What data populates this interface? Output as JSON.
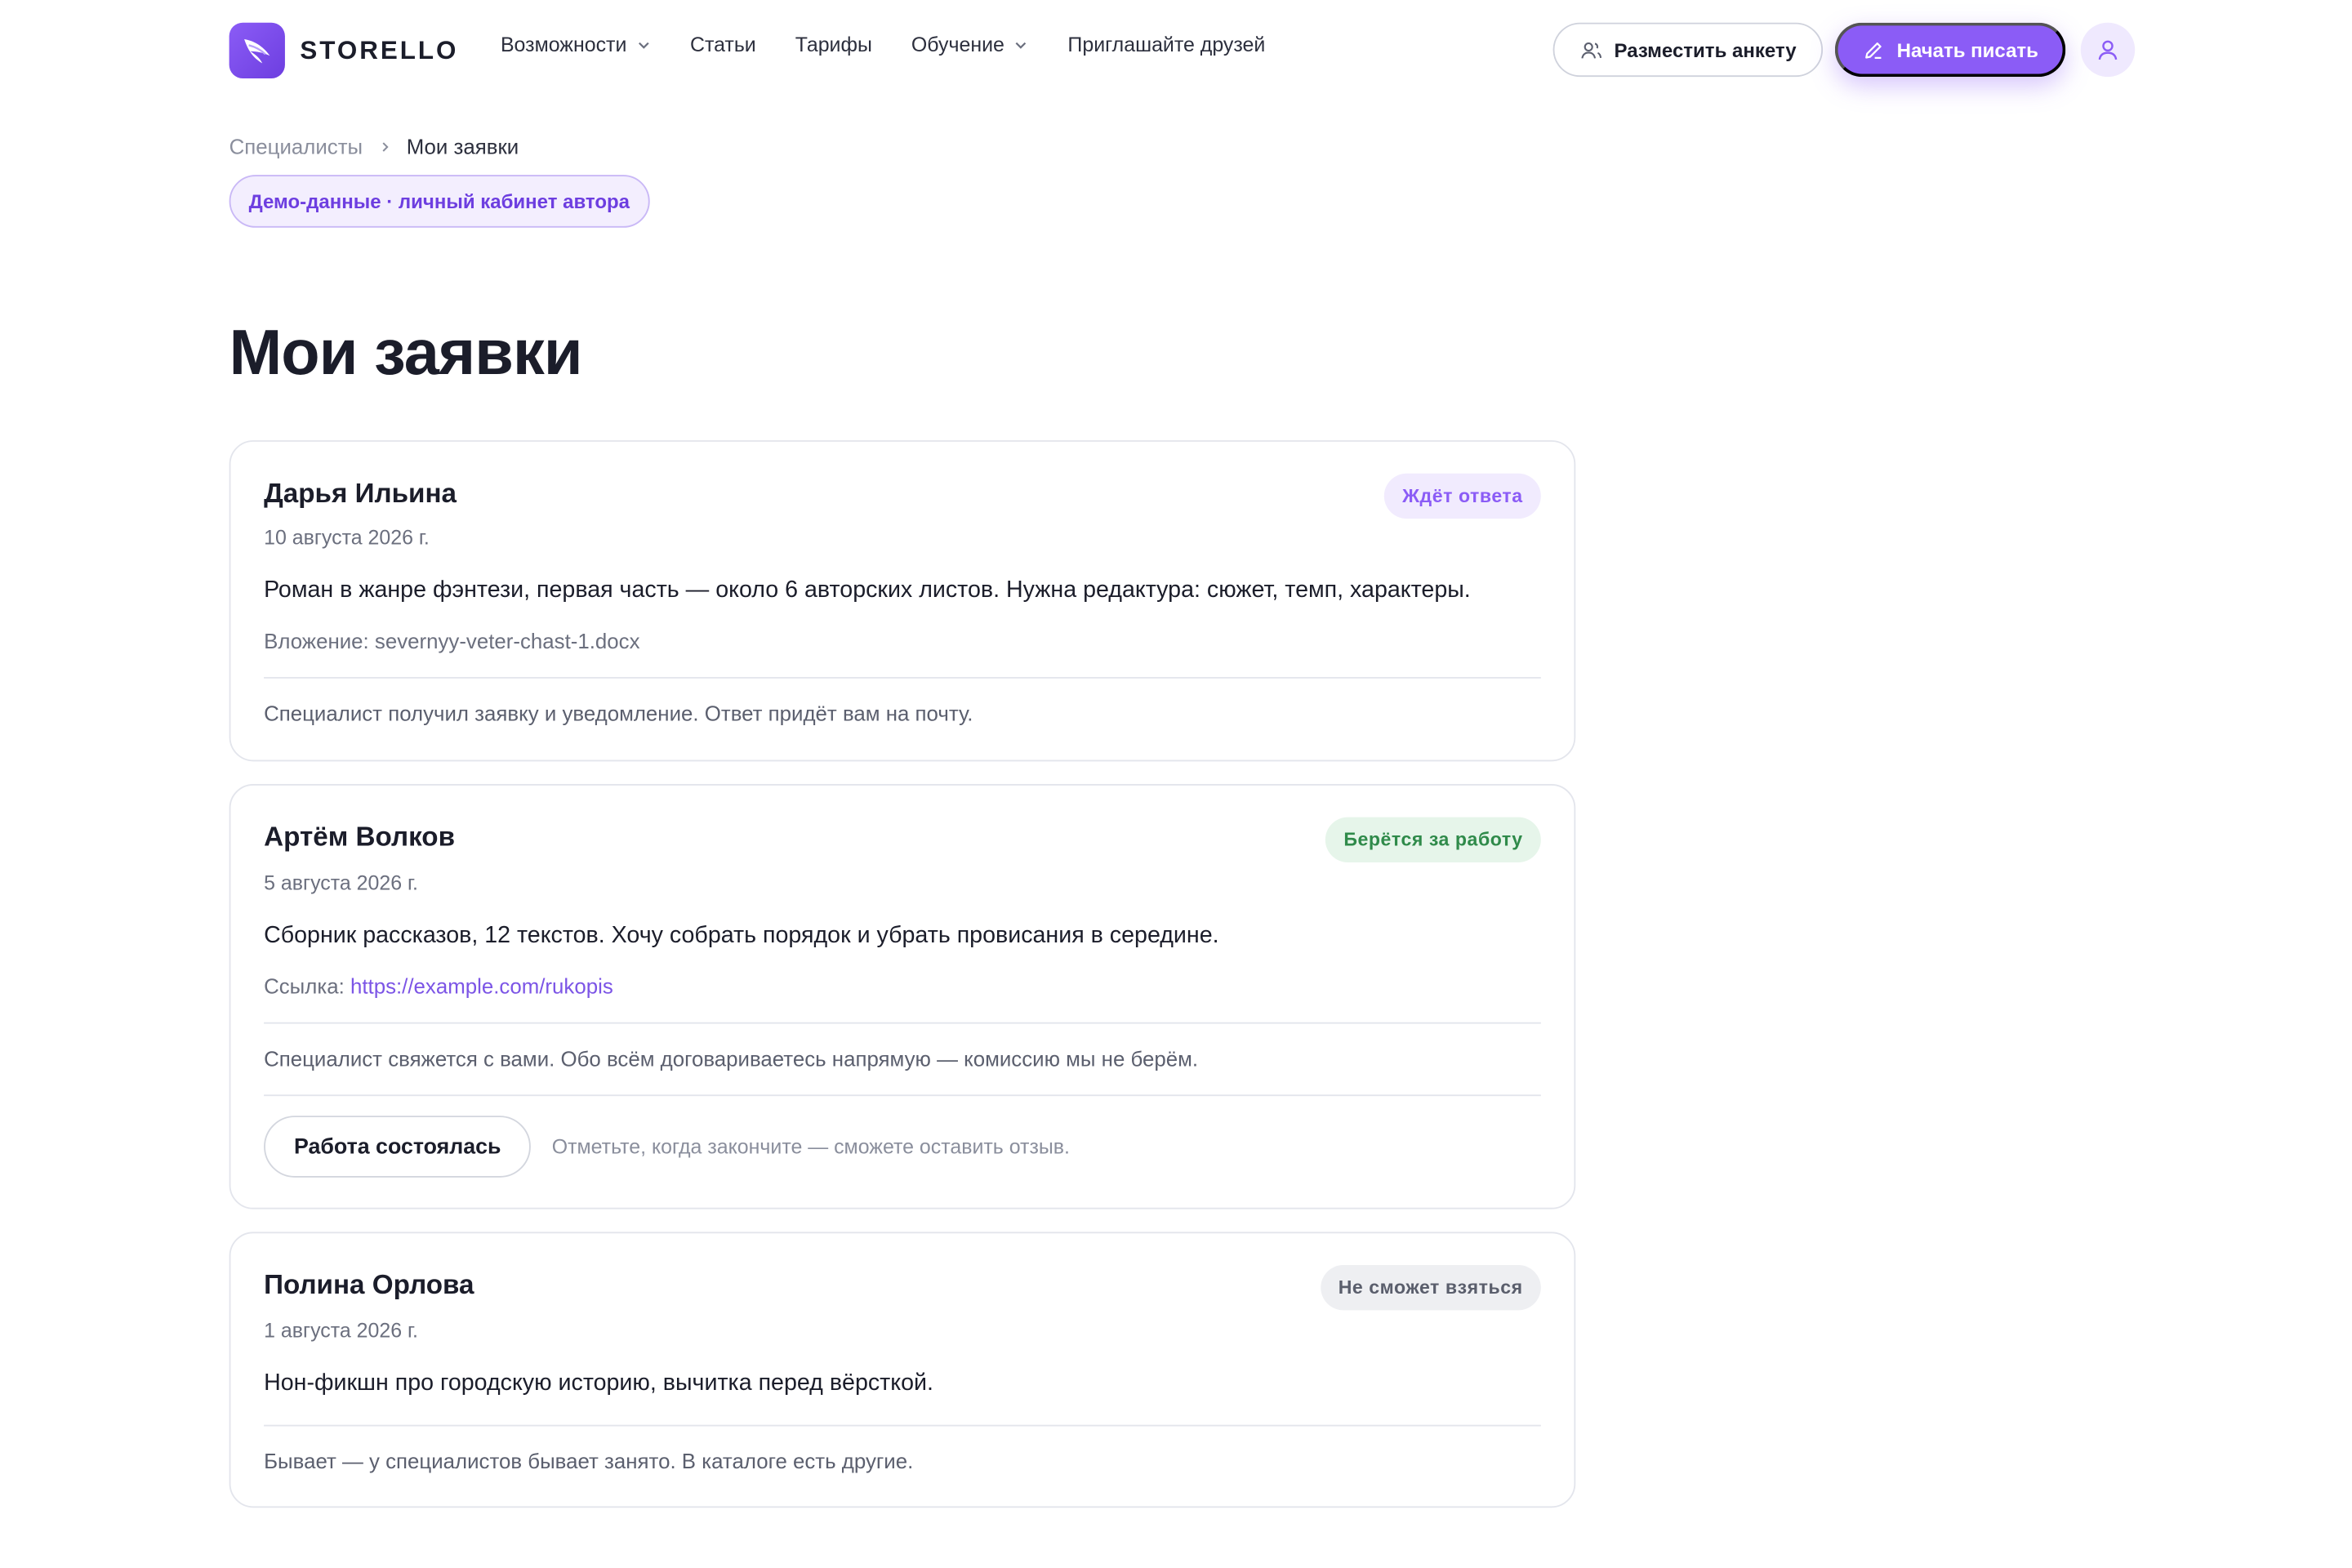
{
  "header": {
    "brand": "STORELLO",
    "nav": [
      {
        "label": "Возможности",
        "has_dropdown": true
      },
      {
        "label": "Статьи",
        "has_dropdown": false
      },
      {
        "label": "Тарифы",
        "has_dropdown": false
      },
      {
        "label": "Обучение",
        "has_dropdown": true
      },
      {
        "label": "Приглашайте друзей",
        "has_dropdown": false
      }
    ],
    "post_profile_label": "Разместить анкету",
    "start_writing_label": "Начать писать"
  },
  "breadcrumb": {
    "parent": "Специалисты",
    "current": "Мои заявки"
  },
  "demo_badge": "Демо-данные · личный кабинет автора",
  "page_title": "Мои заявки",
  "requests": [
    {
      "name": "Дарья Ильина",
      "date": "10 августа 2026 г.",
      "status": "Ждёт ответа",
      "description": "Роман в жанре фэнтези, первая часть — около 6 авторских листов. Нужна редактура: сюжет, темп, характеры.",
      "attachment_label": "Вложение:",
      "attachment_value": "severnyy-veter-chast-1.docx",
      "note": "Специалист получил заявку и уведомление. Ответ придёт вам на почту."
    },
    {
      "name": "Артём Волков",
      "date": "5 августа 2026 г.",
      "status": "Берётся за работу",
      "description": "Сборник рассказов, 12 текстов. Хочу собрать порядок и убрать провисания в середине.",
      "link_label": "Ссылка:",
      "link_value": "https://example.com/rukopis",
      "note": "Специалист свяжется с вами. Обо всём договариваетесь напрямую — комиссию мы не берём.",
      "done_button": "Работа состоялась",
      "done_hint": "Отметьте, когда закончите — сможете оставить отзыв."
    },
    {
      "name": "Полина Орлова",
      "date": "1 августа 2026 г.",
      "status": "Не сможет взяться",
      "description": "Нон-фикшн про городскую историю, вычитка перед вёрсткой.",
      "note": "Бывает — у специалистов бывает занято. В каталоге есть другие."
    }
  ],
  "colors": {
    "accent": "#8b5cf6",
    "status_waiting": "#8b5cf6",
    "status_accepted": "#2f8a4a",
    "status_declined": "#5a5e6c"
  },
  "icons": {
    "logo": "feather-logo-icon",
    "dropdown": "chevron-down-icon",
    "post_profile": "users-icon",
    "start_writing": "pencil-icon",
    "account": "user-icon",
    "breadcrumb_separator": "chevron-right-icon"
  }
}
